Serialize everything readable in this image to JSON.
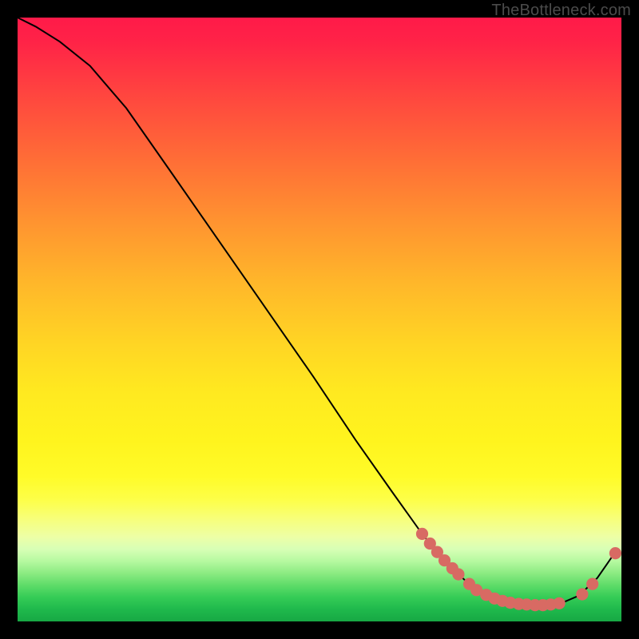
{
  "watermark": "TheBottleneck.com",
  "colors": {
    "marker": "#d86a63",
    "line": "#000000"
  },
  "chart_data": {
    "type": "line",
    "title": "",
    "xlabel": "",
    "ylabel": "",
    "xlim": [
      0,
      100
    ],
    "ylim": [
      0,
      100
    ],
    "grid": false,
    "legend": false,
    "series": [
      {
        "name": "curve",
        "x": [
          0,
          3,
          7,
          12,
          18,
          25,
          33,
          41,
          49,
          56,
          62,
          67,
          70,
          73,
          75,
          78,
          81,
          84,
          87,
          90,
          93,
          96,
          99
        ],
        "y": [
          100,
          98.5,
          96,
          92,
          85,
          75,
          63.5,
          52,
          40.5,
          30,
          21.5,
          14.5,
          10.8,
          7.8,
          6,
          4.3,
          3.3,
          2.8,
          2.7,
          3,
          4.3,
          7.2,
          11.5
        ]
      }
    ],
    "markers": [
      {
        "x": 67.0,
        "y": 14.5
      },
      {
        "x": 68.3,
        "y": 12.9
      },
      {
        "x": 69.5,
        "y": 11.5
      },
      {
        "x": 70.7,
        "y": 10.1
      },
      {
        "x": 72.0,
        "y": 8.8
      },
      {
        "x": 73.0,
        "y": 7.8
      },
      {
        "x": 74.8,
        "y": 6.2
      },
      {
        "x": 76.0,
        "y": 5.2
      },
      {
        "x": 77.6,
        "y": 4.4
      },
      {
        "x": 79.0,
        "y": 3.8
      },
      {
        "x": 80.3,
        "y": 3.4
      },
      {
        "x": 81.6,
        "y": 3.1
      },
      {
        "x": 83.0,
        "y": 2.9
      },
      {
        "x": 84.3,
        "y": 2.8
      },
      {
        "x": 85.7,
        "y": 2.7
      },
      {
        "x": 87.0,
        "y": 2.7
      },
      {
        "x": 88.3,
        "y": 2.8
      },
      {
        "x": 89.7,
        "y": 3.0
      },
      {
        "x": 93.5,
        "y": 4.5
      },
      {
        "x": 95.2,
        "y": 6.2
      },
      {
        "x": 99.0,
        "y": 11.3
      }
    ],
    "marker_radius_frac": 0.01
  }
}
